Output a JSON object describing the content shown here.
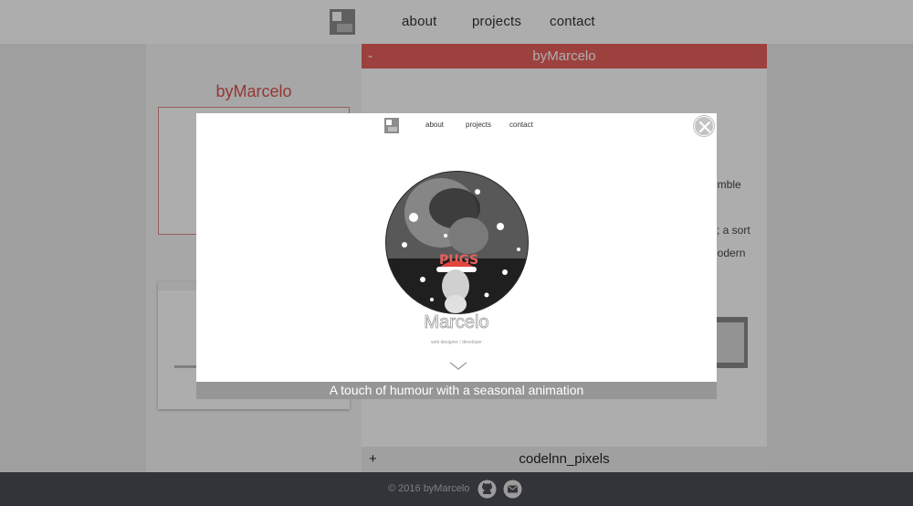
{
  "header": {
    "logo_icon": "byMarcelo-logo-icon",
    "nav": [
      {
        "label": "about"
      },
      {
        "label": "projects"
      },
      {
        "label": "contact"
      }
    ]
  },
  "projects": {
    "brand_title": "byMarcelo",
    "open_panel": {
      "sign": "-",
      "title": "byMarcelo"
    },
    "collapsed_panel": {
      "sign": "+",
      "title": "codelnn_pixels"
    },
    "peek_text": [
      "umble",
      "it; a sort",
      "nodern"
    ]
  },
  "modal": {
    "nav": [
      {
        "label": "about"
      },
      {
        "label": "projects"
      },
      {
        "label": "contact"
      }
    ],
    "name": "Marcelo",
    "subtitle": "web designer / developer",
    "hat_text": "PUGS",
    "caption": "A touch of humour with a seasonal animation",
    "close_icon": "close-icon",
    "scroll_icon": "chevron-down-icon"
  },
  "footer": {
    "copyright": "© 2016 byMarcelo",
    "icons": [
      "github-icon",
      "email-icon"
    ]
  },
  "colors": {
    "accent": "#e8605c",
    "footer_bg": "#4a4d55",
    "caption_bg": "#969696"
  }
}
